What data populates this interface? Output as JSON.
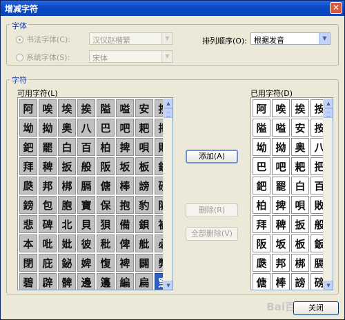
{
  "window": {
    "title": "增减字符",
    "close_glyph": "✕"
  },
  "font_group": {
    "label": "字体",
    "calligraphy_label": "书法字体(C):",
    "calligraphy_value": "汉仪赵楷繁",
    "system_label": "系统字体(S):",
    "system_value": "宋体",
    "sort_label": "排列顺序(O):",
    "sort_value": "根据发音"
  },
  "char_group": {
    "label": "字符",
    "available_label": "可用字符(L)",
    "used_label": "已用字符(D)"
  },
  "buttons": {
    "add": "添加(A)",
    "delete": "删除(R)",
    "delete_all": "全部删除(V)",
    "close": "关闭"
  },
  "available_chars": [
    "阿",
    "唉",
    "埃",
    "挨",
    "隘",
    "嗌",
    "安",
    "按",
    "坳",
    "拗",
    "奥",
    "八",
    "巴",
    "吧",
    "耙",
    "把",
    "鈀",
    "罷",
    "白",
    "百",
    "柏",
    "捭",
    "唄",
    "敗",
    "拜",
    "稗",
    "扳",
    "般",
    "阪",
    "坂",
    "板",
    "鈑",
    "瓞",
    "邦",
    "梆",
    "膈",
    "傏",
    "棒",
    "謗",
    "磅",
    "鎊",
    "包",
    "胞",
    "寶",
    "保",
    "抱",
    "豹",
    "陂",
    "悲",
    "碑",
    "北",
    "貝",
    "狽",
    "備",
    "鋇",
    "被",
    "本",
    "吡",
    "妣",
    "彼",
    "秕",
    "俾",
    "舭",
    "必",
    "閉",
    "庇",
    "鉍",
    "婢",
    "愎",
    "裨",
    "闢",
    "弊",
    "碧",
    "辟",
    "髀",
    "邊",
    "籩",
    "編",
    "扁",
    "窆"
  ],
  "selected_available_index": 79,
  "used_chars": [
    "阿",
    "唉",
    "挨",
    "按",
    "隘",
    "嗌",
    "安",
    "按",
    "坳",
    "拗",
    "奥",
    "八",
    "巴",
    "吧",
    "耙",
    "把",
    "鈀",
    "罷",
    "白",
    "百",
    "柏",
    "捭",
    "唄",
    "敗",
    "拜",
    "稗",
    "扳",
    "般",
    "阪",
    "坂",
    "板",
    "鈑",
    "瓞",
    "邦",
    "梆",
    "膈",
    "傏",
    "棒",
    "謗",
    "磅"
  ],
  "watermark": "Bai百度"
}
